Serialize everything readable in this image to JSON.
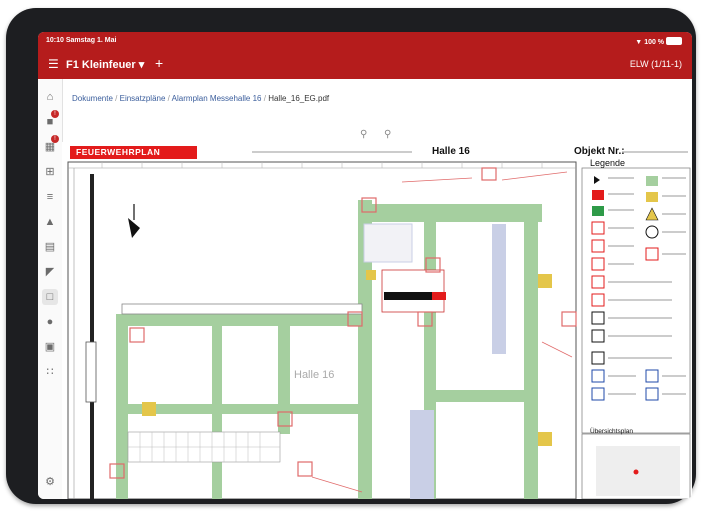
{
  "status": {
    "time": "10:10  Samstag 1. Mai",
    "battery": "100 %"
  },
  "appbar": {
    "title": "F1 Kleinfeuer ▾",
    "unit": "ELW (1/11-1)"
  },
  "breadcrumb": {
    "items": [
      "Dokumente",
      "Einsatzpläne",
      "Alarmplan Messehalle 16"
    ],
    "current": "Halle_16_EG.pdf"
  },
  "plan": {
    "tag": "FEUERWEHRPLAN",
    "hall": "Halle 16",
    "object_label": "Objekt Nr.:",
    "legend_title": "Legende",
    "overview_title": "Übersichtsplan",
    "room_label": "Halle 16"
  },
  "colors": {
    "brand": "#b51c1c",
    "plan_red": "#e31b1b",
    "corridor": "#a5cf9f",
    "stair": "#c9cfe6",
    "sign": "#e4c64a"
  }
}
